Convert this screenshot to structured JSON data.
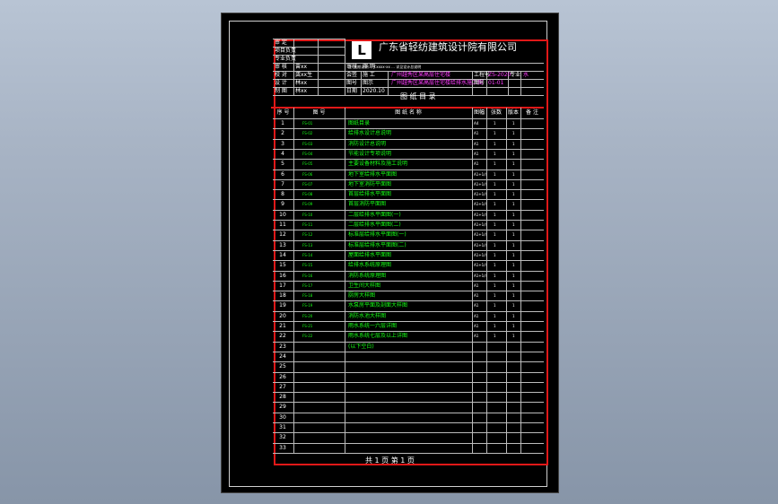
{
  "title_block": {
    "left_labels": [
      "审 定",
      "项目负责",
      "专业负责",
      "审 核",
      "校 对",
      "设 计",
      "制 图"
    ],
    "left_names": [
      "",
      "",
      "",
      "曾xx",
      "龚xx生",
      "林xx",
      "林xx"
    ],
    "mid_labels": [
      "审核",
      "会签",
      "图号",
      "日期"
    ],
    "mid_values": [
      "邓 明",
      "施 工",
      "图示",
      "2020.10"
    ],
    "company": "广东省轻纺建筑设计院有限公司",
    "logo_text": "L",
    "header_note": "注: 图纸说明... V.xxxx-xx ... 详见设计总说明",
    "project_name": "广州越秀区某高层住宅楼",
    "sub_name": "广州越秀区某高层住宅楼给排水施工图",
    "code_label1": "工程号",
    "code_value1": "ZS-2020",
    "code_label2": "专业",
    "code_value2": "水",
    "code_label3": "图号",
    "code_value3": "01-01",
    "drawing_title": "图 纸 目 录",
    "page_info": "共 1 页 第 1 页"
  },
  "columns": [
    "序 号",
    "图 号",
    "图 纸 名 称",
    "图幅",
    "张数",
    "版本",
    "备 注"
  ],
  "rows": [
    {
      "n": "1",
      "code": "FS-01",
      "name": "图纸目录",
      "size": "A4",
      "q": "1",
      "v": "1"
    },
    {
      "n": "2",
      "code": "FS-02",
      "name": "给排水设计总说明",
      "size": "A1",
      "q": "1",
      "v": "1"
    },
    {
      "n": "3",
      "code": "FS-03",
      "name": "消防设计总说明",
      "size": "A1",
      "q": "1",
      "v": "1"
    },
    {
      "n": "4",
      "code": "FS-04",
      "name": "节能设计专项说明",
      "size": "A1",
      "q": "1",
      "v": "1"
    },
    {
      "n": "5",
      "code": "FS-05",
      "name": "主要设备材料及施工说明",
      "size": "A1",
      "q": "1",
      "v": "1"
    },
    {
      "n": "6",
      "code": "FS-06",
      "name": "地下室给排水平面图",
      "size": "A1+1/4",
      "q": "1",
      "v": "1"
    },
    {
      "n": "7",
      "code": "FS-07",
      "name": "地下室消防平面图",
      "size": "A1+1/4",
      "q": "1",
      "v": "1"
    },
    {
      "n": "8",
      "code": "FS-08",
      "name": "首层给排水平面图",
      "size": "A1+1/4",
      "q": "1",
      "v": "1"
    },
    {
      "n": "9",
      "code": "FS-09",
      "name": "首层消防平面图",
      "size": "A1+1/4",
      "q": "1",
      "v": "1"
    },
    {
      "n": "10",
      "code": "FS-10",
      "name": "二层给排水平面图(一)",
      "size": "A1+1/4",
      "q": "1",
      "v": "1"
    },
    {
      "n": "11",
      "code": "FS-11",
      "name": "二层给排水平面图(二)",
      "size": "A1+1/4",
      "q": "1",
      "v": "1"
    },
    {
      "n": "12",
      "code": "FS-12",
      "name": "标准层给排水平面图(一)",
      "size": "A1+1/4",
      "q": "1",
      "v": "1"
    },
    {
      "n": "13",
      "code": "FS-13",
      "name": "标准层给排水平面图(二)",
      "size": "A1+1/4",
      "q": "1",
      "v": "1"
    },
    {
      "n": "14",
      "code": "FS-14",
      "name": "屋面给排水平面图",
      "size": "A1+1/4",
      "q": "1",
      "v": "1"
    },
    {
      "n": "15",
      "code": "FS-15",
      "name": "给排水系统原理图",
      "size": "A1+1/4",
      "q": "1",
      "v": "1"
    },
    {
      "n": "16",
      "code": "FS-16",
      "name": "消防系统原理图",
      "size": "A1+1/4",
      "q": "1",
      "v": "1"
    },
    {
      "n": "17",
      "code": "FS-17",
      "name": "卫生间大样图",
      "size": "A1",
      "q": "1",
      "v": "1"
    },
    {
      "n": "18",
      "code": "FS-18",
      "name": "厨房大样图",
      "size": "A1",
      "q": "1",
      "v": "1"
    },
    {
      "n": "19",
      "code": "FS-19",
      "name": "水泵房平面及剖面大样图",
      "size": "A1",
      "q": "1",
      "v": "1"
    },
    {
      "n": "20",
      "code": "FS-20",
      "name": "消防水池大样图",
      "size": "A1",
      "q": "1",
      "v": "1"
    },
    {
      "n": "21",
      "code": "FS-21",
      "name": "雨水系统一六层详图",
      "size": "A1",
      "q": "1",
      "v": "1"
    },
    {
      "n": "22",
      "code": "FS-22",
      "name": "雨水系统七层及以上详图",
      "size": "A1",
      "q": "1",
      "v": "1"
    },
    {
      "n": "23",
      "code": "",
      "name": "(以下空白)",
      "size": "",
      "q": "",
      "v": ""
    },
    {
      "n": "24",
      "code": "",
      "name": "",
      "size": "",
      "q": "",
      "v": ""
    },
    {
      "n": "25",
      "code": "",
      "name": "",
      "size": "",
      "q": "",
      "v": ""
    },
    {
      "n": "26",
      "code": "",
      "name": "",
      "size": "",
      "q": "",
      "v": ""
    },
    {
      "n": "27",
      "code": "",
      "name": "",
      "size": "",
      "q": "",
      "v": ""
    },
    {
      "n": "28",
      "code": "",
      "name": "",
      "size": "",
      "q": "",
      "v": ""
    },
    {
      "n": "29",
      "code": "",
      "name": "",
      "size": "",
      "q": "",
      "v": ""
    },
    {
      "n": "30",
      "code": "",
      "name": "",
      "size": "",
      "q": "",
      "v": ""
    },
    {
      "n": "31",
      "code": "",
      "name": "",
      "size": "",
      "q": "",
      "v": ""
    },
    {
      "n": "32",
      "code": "",
      "name": "",
      "size": "",
      "q": "",
      "v": ""
    },
    {
      "n": "33",
      "code": "",
      "name": "",
      "size": "",
      "q": "",
      "v": ""
    }
  ],
  "colors": {
    "frame": "#e01818",
    "text": "#ffffff",
    "green": "#16ff16",
    "magenta": "#ff3cff",
    "paper": "#000000"
  }
}
